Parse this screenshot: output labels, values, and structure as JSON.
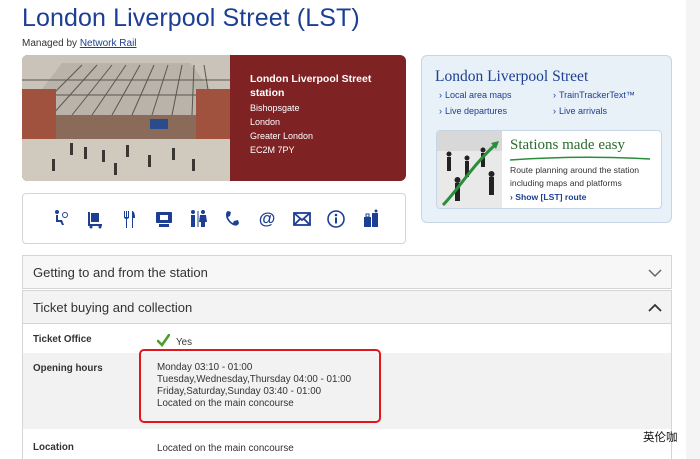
{
  "page": {
    "title": "London Liverpool Street (LST)",
    "managed_by_prefix": "Managed by",
    "managed_by_link": "Network Rail"
  },
  "station": {
    "name": "London Liverpool Street station",
    "address": [
      "Bishopsgate",
      "London",
      "Greater London",
      "EC2M 7PY"
    ]
  },
  "facilities": {
    "icons": [
      "accessibility-icon",
      "trolley-icon",
      "food-icon",
      "cash-machine-icon",
      "toilets-icon",
      "telephone-icon",
      "internet-icon",
      "post-box-icon",
      "information-icon",
      "left-luggage-icon"
    ]
  },
  "promo": {
    "title": "London Liverpool Street",
    "links": [
      "Local area maps",
      "TrainTrackerText™",
      "Live departures",
      "Live arrivals"
    ],
    "sme_title": "Stations made easy",
    "sme_description": "Route planning around the station including maps and platforms",
    "sme_link": "Show [LST] route"
  },
  "accordion": {
    "section1": "Getting to and from the station",
    "section2": "Ticket buying and collection"
  },
  "ticket_info": {
    "rows": [
      {
        "label": "Ticket Office",
        "value": "Yes"
      },
      {
        "label": "Opening hours",
        "lines": [
          "Monday 03:10 - 01:00",
          "Tuesday,Wednesday,Thursday 04:00 - 01:00",
          "Friday,Saturday,Sunday 03:40 - 01:00",
          "Located on the main concourse"
        ]
      },
      {
        "label": "Location",
        "value": "Located on the main concourse"
      }
    ]
  },
  "watermark": "英伦咖",
  "colors": {
    "title_blue": "#1c3f94",
    "hero_maroon": "#7f2224",
    "promo_bg": "#e8f0f8",
    "sme_green": "#2a6b2e",
    "highlight_red": "#e8141c",
    "tick_green": "#4aa02c"
  }
}
